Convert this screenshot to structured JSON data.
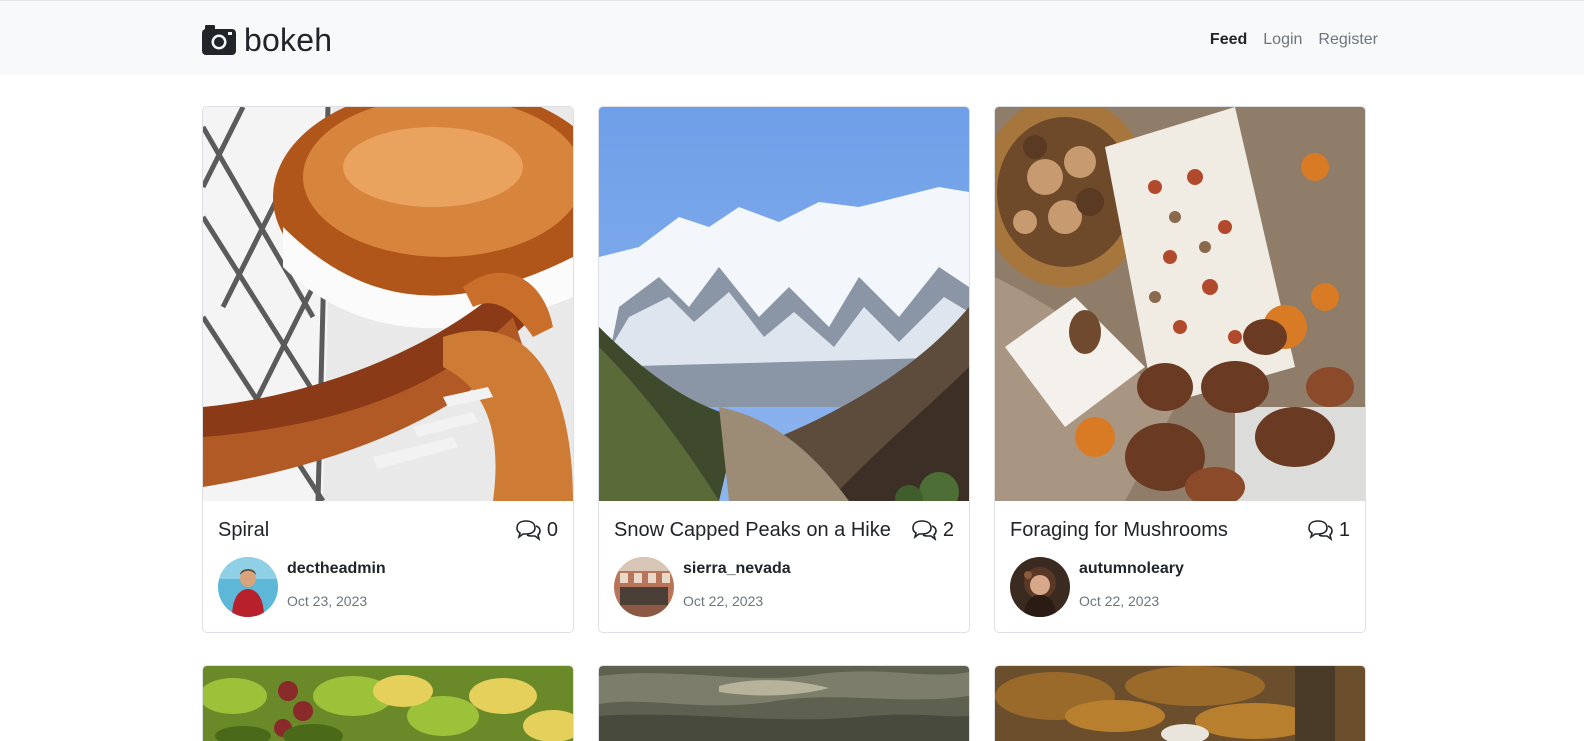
{
  "brand": {
    "name": "bokeh",
    "icon": "camera-icon"
  },
  "nav": {
    "feed": "Feed",
    "login": "Login",
    "register": "Register"
  },
  "posts": [
    {
      "title": "Spiral",
      "comments": "0",
      "user": "dectheadmin",
      "date": "Oct 23, 2023",
      "image": "spiral-staircase-photo"
    },
    {
      "title": "Snow Capped Peaks on a Hike",
      "comments": "2",
      "user": "sierra_nevada",
      "date": "Oct 22, 2023",
      "image": "snowy-mountains-photo"
    },
    {
      "title": "Foraging for Mushrooms",
      "comments": "1",
      "user": "autumnoleary",
      "date": "Oct 22, 2023",
      "image": "mushrooms-photo"
    }
  ],
  "more_posts": [
    {
      "image": "bananas-market-photo"
    },
    {
      "image": "water-landscape-photo"
    },
    {
      "image": "autumn-forest-photo"
    }
  ],
  "colors": {
    "navbar_bg": "#f8f9fa",
    "active_nav": "#212529",
    "muted_text": "#6c757d"
  }
}
